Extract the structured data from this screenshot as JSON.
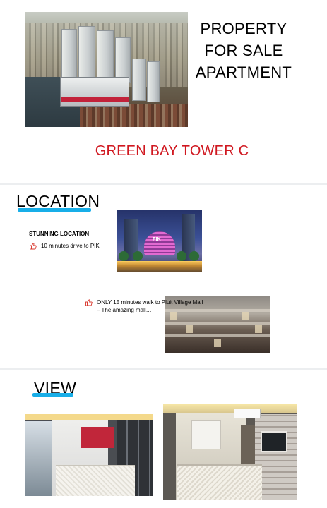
{
  "slide1": {
    "title_lines": [
      "PROPERTY",
      "FOR SALE",
      "APARTMENT"
    ],
    "tower_name": "GREEN BAY TOWER C"
  },
  "slide2": {
    "heading": "LOCATION",
    "subheading": "STUNNING LOCATION",
    "bullets": [
      "10 minutes drive to PIK",
      "ONLY 15 minutes walk to Pluit Village Mall",
      "– The amazing mall…"
    ],
    "image_text": "PIK"
  },
  "slide3": {
    "heading": "VIEW"
  },
  "colors": {
    "accent_red": "#d01820",
    "underline_blue": "#18aee8",
    "thumb_icon": "#d8342a"
  },
  "icons": [
    "thumbs-up-icon"
  ]
}
